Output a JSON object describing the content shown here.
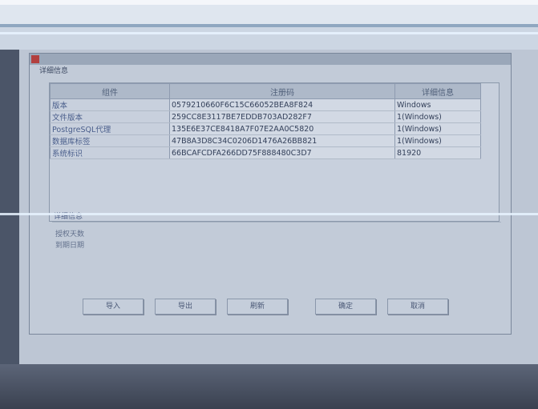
{
  "dialog": {
    "title": "",
    "group_label": "详细信息"
  },
  "table": {
    "columns": [
      "组件",
      "注册码",
      "详细信息"
    ],
    "rows": [
      {
        "name": "版本",
        "value": "0579210660F6C15C66052BEA8F824",
        "detail": "Windows"
      },
      {
        "name": "文件版本",
        "value": "259CC8E3117BE7EDDB703AD282F7",
        "detail": "1(Windows)"
      },
      {
        "name": "PostgreSQL代理",
        "value": "135E6E37CE8418A7F07E2AA0C5820",
        "detail": "1(Windows)"
      },
      {
        "name": "数据库标签",
        "value": "47B8A3D8C34C0206D1476A26BB821",
        "detail": "1(Windows)"
      },
      {
        "name": "系统标识",
        "value": "66BCAFCDFA266DD75F888480C3D7",
        "detail": "81920"
      }
    ]
  },
  "info": {
    "heading": "详细信息",
    "line1": "授权天数",
    "line2": "到期日期"
  },
  "buttons": {
    "b1": "导入",
    "b2": "导出",
    "b3": "刷新",
    "b4": "确定",
    "b5": "取消"
  }
}
